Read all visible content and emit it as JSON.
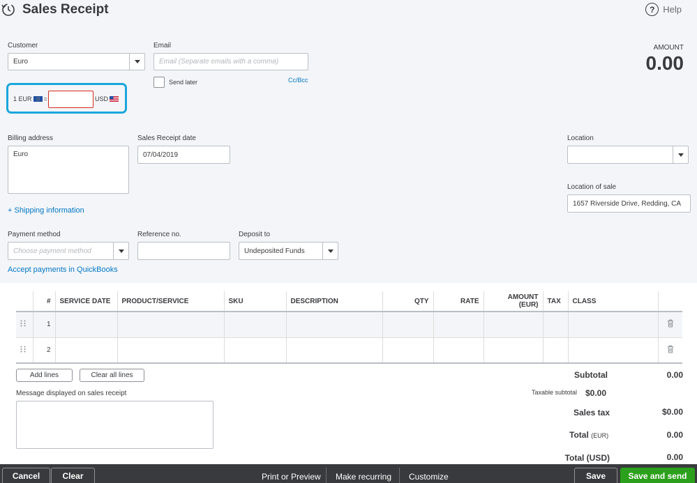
{
  "header": {
    "title": "Sales Receipt",
    "help_label": "Help",
    "help_glyph": "?"
  },
  "customer": {
    "label": "Customer",
    "value": "Euro"
  },
  "email": {
    "label": "Email",
    "placeholder": "Email (Separate emails with a comma)",
    "send_later_label": "Send later",
    "cc_bcc_label": "Cc/Bcc"
  },
  "exchange": {
    "base": "1 EUR",
    "equals": "=",
    "value": "",
    "target": "USD"
  },
  "amount": {
    "label": "AMOUNT",
    "value": "0.00"
  },
  "billing": {
    "label": "Billing address",
    "value": "Euro"
  },
  "receipt_date": {
    "label": "Sales Receipt date",
    "value": "07/04/2019"
  },
  "location": {
    "label": "Location",
    "value": ""
  },
  "location_of_sale": {
    "label": "Location of sale",
    "value": "1657 Riverside Drive, Redding, CA"
  },
  "shipping_link": "+ Shipping information",
  "payment_method": {
    "label": "Payment method",
    "placeholder": "Choose payment method"
  },
  "reference": {
    "label": "Reference no.",
    "value": ""
  },
  "deposit": {
    "label": "Deposit to",
    "value": "Undeposited Funds"
  },
  "accept_payments_link": "Accept payments in QuickBooks",
  "table": {
    "headers": [
      "",
      "#",
      "SERVICE DATE",
      "PRODUCT/SERVICE",
      "SKU",
      "DESCRIPTION",
      "QTY",
      "RATE",
      "AMOUNT (EUR)",
      "TAX",
      "CLASS",
      ""
    ],
    "rows": [
      {
        "num": "1"
      },
      {
        "num": "2"
      }
    ]
  },
  "actions": {
    "add_lines": "Add lines",
    "clear_all_lines": "Clear all lines"
  },
  "message": {
    "label": "Message displayed on sales receipt",
    "value": ""
  },
  "totals": {
    "subtotal_label": "Subtotal",
    "subtotal_value": "0.00",
    "taxable_label": "Taxable subtotal",
    "taxable_value": "$0.00",
    "sales_tax_label": "Sales tax",
    "sales_tax_value": "$0.00",
    "total_label": "Total",
    "total_currency": "(EUR)",
    "total_value": "0.00",
    "total_usd_label": "Total (USD)",
    "total_usd_value": "0.00"
  },
  "footer": {
    "cancel": "Cancel",
    "clear": "Clear",
    "print_preview": "Print or Preview",
    "make_recurring": "Make recurring",
    "customize": "Customize",
    "save": "Save",
    "save_send": "Save and send"
  },
  "colors": {
    "accent_blue": "#0077c5",
    "highlight": "#1aa6dd",
    "green": "#2ca01c",
    "footer_bg": "#393a3d",
    "error_red": "#d52b1e"
  }
}
